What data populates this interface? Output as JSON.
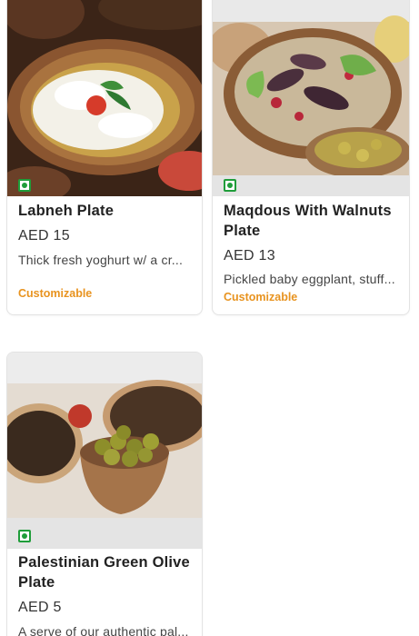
{
  "items": [
    {
      "title": "Labneh Plate",
      "price": "AED 15",
      "description": "Thick fresh yoghurt w/ a cr...",
      "tag": "Customizable",
      "veg": true
    },
    {
      "title": "Maqdous With Walnuts Plate",
      "price": "AED 13",
      "description": "Pickled baby eggplant, stuff...",
      "tag": "Customizable",
      "veg": true
    },
    {
      "title": "Palestinian Green Olive Plate",
      "price": "AED 5",
      "description": "A serve of our authentic pal...",
      "veg": true
    }
  ],
  "colors": {
    "veg_badge": "#1f9d3a",
    "customizable": "#e8931f"
  }
}
